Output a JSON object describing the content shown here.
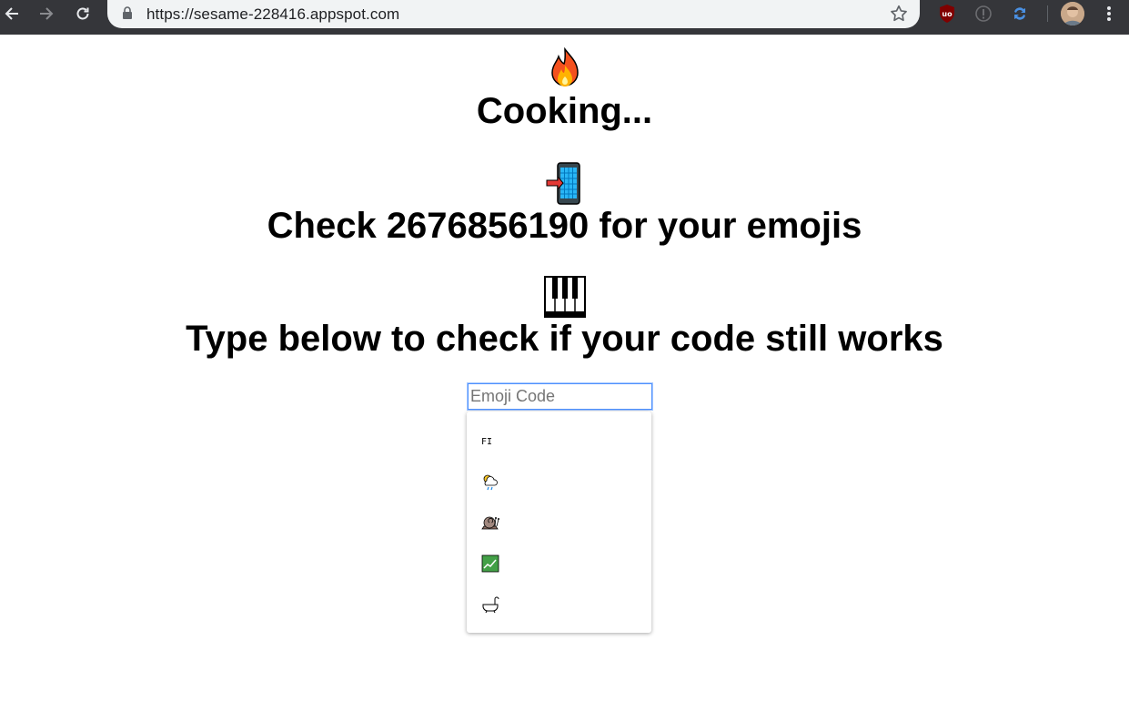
{
  "browser": {
    "url": "https://sesame-228416.appspot.com",
    "icons": [
      "back-arrow-icon",
      "forward-arrow-icon",
      "reload-icon",
      "lock-icon",
      "bookmark-star-icon",
      "ublock-icon",
      "extension-info-icon",
      "sync-arrows-icon",
      "profile-avatar",
      "kebab-menu-icon"
    ]
  },
  "page": {
    "sections": [
      {
        "emoji": "fire-icon",
        "heading": "Cooking..."
      },
      {
        "emoji": "mobile-phone-arrow-icon",
        "heading": "Check 2676856190 for your emojis"
      },
      {
        "emoji": "piano-keys-icon",
        "heading": "Type below to check if your code still works"
      }
    ],
    "input": {
      "placeholder": "Emoji Code",
      "value": ""
    },
    "dropdown": {
      "items": [
        {
          "kind": "text",
          "label": "FI"
        },
        {
          "kind": "emoji",
          "icon": "sun-behind-rain-cloud-icon"
        },
        {
          "kind": "emoji",
          "icon": "snail-icon"
        },
        {
          "kind": "emoji",
          "icon": "chart-increasing-icon"
        },
        {
          "kind": "emoji",
          "icon": "bathtub-icon"
        }
      ]
    }
  },
  "colors": {
    "chrome_bg": "#35363a",
    "omnibox_bg": "#f1f3f4",
    "input_focus": "#4d90fe"
  }
}
